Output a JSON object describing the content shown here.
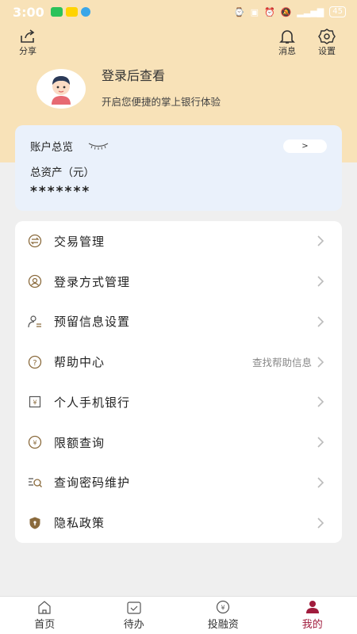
{
  "status_bar": {
    "time": "3:00",
    "battery": "45"
  },
  "top_actions": {
    "share": "分享",
    "messages": "消息",
    "settings": "设置"
  },
  "profile": {
    "title": "登录后查看",
    "subtitle": "开启您便捷的掌上银行体验"
  },
  "account": {
    "overview_label": "账户总览",
    "toggle_label": ">",
    "total_label": "总资产（元）",
    "total_value": "*******"
  },
  "menu": {
    "items": [
      {
        "label": "交易管理",
        "icon": "exchange-icon"
      },
      {
        "label": "登录方式管理",
        "icon": "login-face-icon"
      },
      {
        "label": "预留信息设置",
        "icon": "user-info-icon"
      },
      {
        "label": "帮助中心",
        "icon": "help-icon",
        "hint": "查找帮助信息"
      },
      {
        "label": "个人手机银行",
        "icon": "mobile-bank-icon"
      },
      {
        "label": "限额查询",
        "icon": "limit-icon"
      },
      {
        "label": "查询密码维护",
        "icon": "password-search-icon"
      },
      {
        "label": "隐私政策",
        "icon": "privacy-shield-icon"
      }
    ]
  },
  "tabbar": {
    "tabs": [
      {
        "label": "首页",
        "icon": "home-icon"
      },
      {
        "label": "待办",
        "icon": "todo-icon"
      },
      {
        "label": "投融资",
        "icon": "invest-icon"
      },
      {
        "label": "我的",
        "icon": "user-icon"
      }
    ],
    "active_color": "#a01b3c"
  },
  "colors": {
    "header": "#f8e2b8",
    "card": "#eaf1fb",
    "background": "#efefef"
  }
}
